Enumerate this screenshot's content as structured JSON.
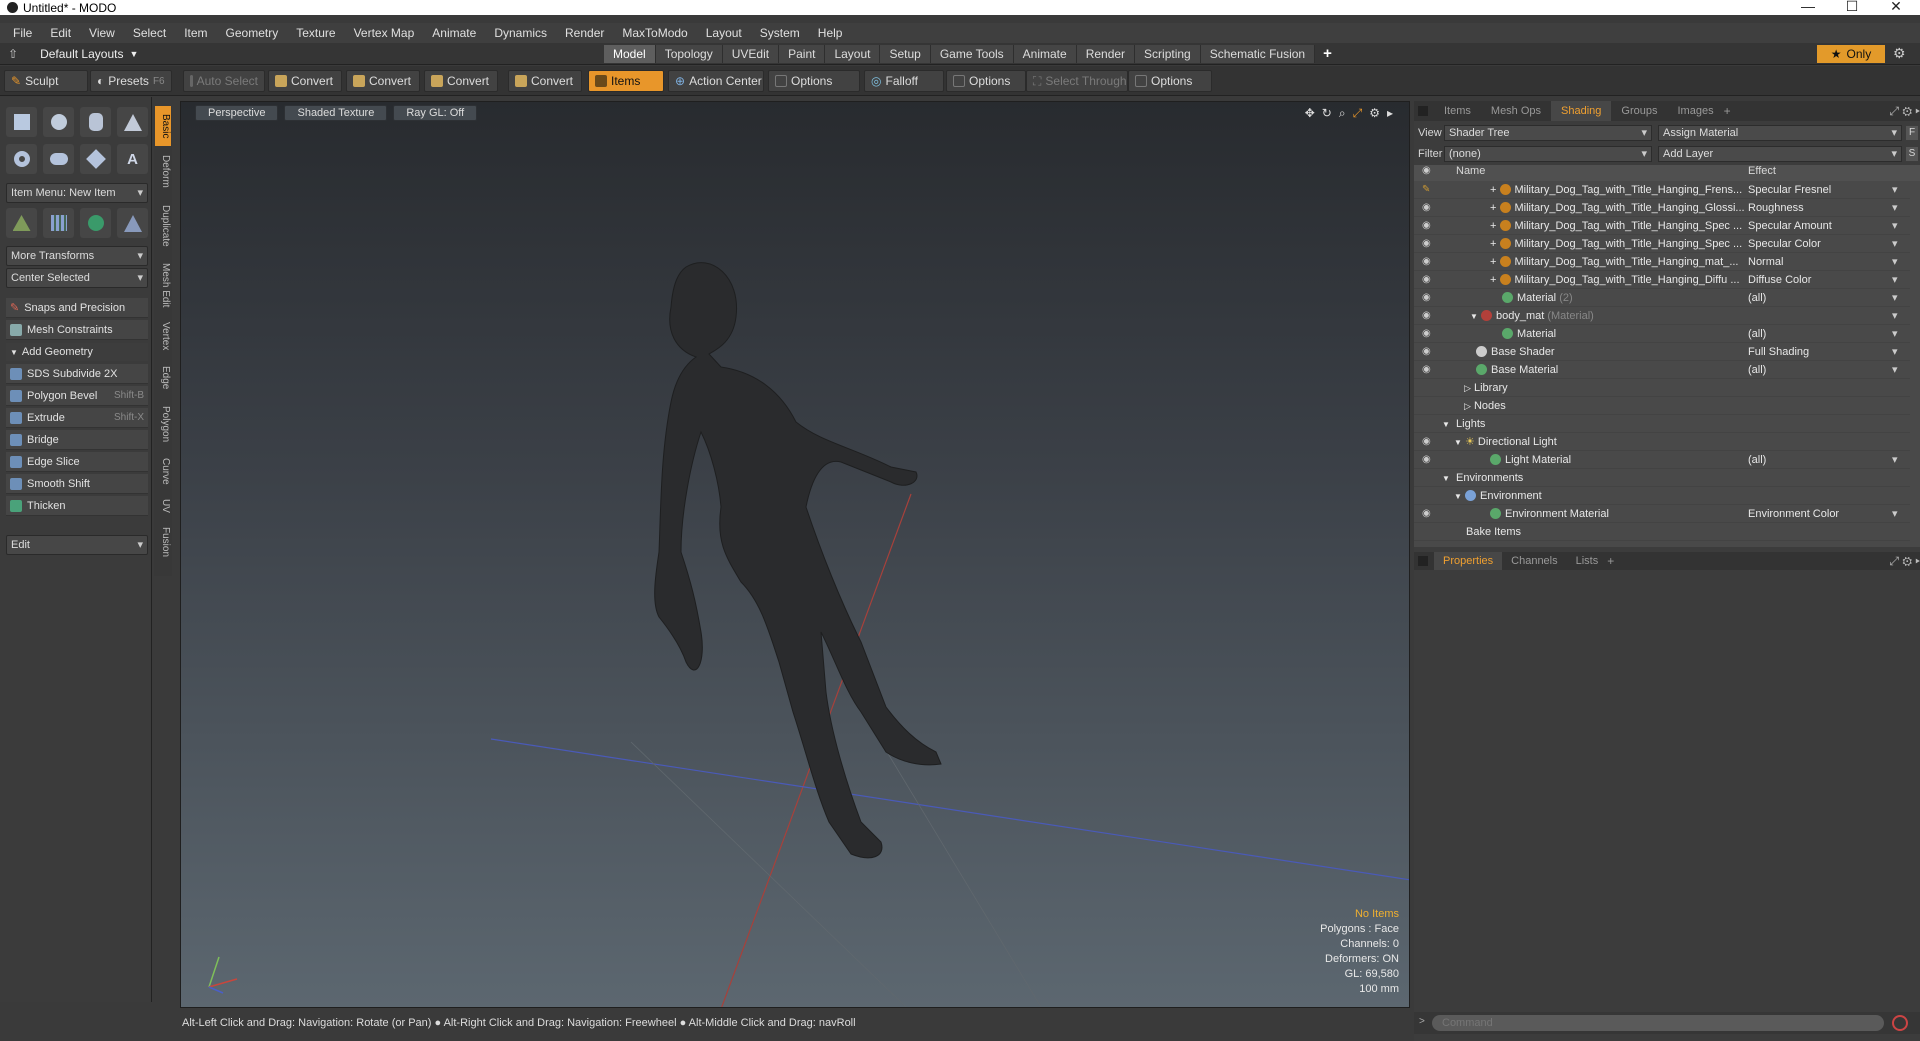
{
  "window": {
    "title": "Untitled* - MODO",
    "minimize": "—",
    "maximize": "☐",
    "close": "✕"
  },
  "menu": [
    "File",
    "Edit",
    "View",
    "Select",
    "Item",
    "Geometry",
    "Texture",
    "Vertex Map",
    "Animate",
    "Dynamics",
    "Render",
    "MaxToModo",
    "Layout",
    "System",
    "Help"
  ],
  "layout": {
    "name": "Default Layouts",
    "tabs": [
      "Model",
      "Topology",
      "UVEdit",
      "Paint",
      "Layout",
      "Setup",
      "Game Tools",
      "Animate",
      "Render",
      "Scripting",
      "Schematic Fusion"
    ],
    "active_tab": "Model",
    "plus": "+",
    "only_label": "Only"
  },
  "toolbar": {
    "sculpt": "Sculpt",
    "presets": "Presets",
    "presets_key": "F6",
    "auto_select": "Auto Select",
    "convert": "Convert",
    "items": "Items",
    "action_center": "Action Center",
    "options": "Options",
    "falloff": "Falloff",
    "select_through": "Select Through"
  },
  "left": {
    "item_menu": "Item Menu: New Item",
    "more_transforms": "More Transforms",
    "center_selected": "Center Selected",
    "snaps": "Snaps and Precision",
    "mesh_constraints": "Mesh Constraints",
    "add_geometry": "Add Geometry",
    "tools": [
      {
        "label": "SDS Subdivide 2X",
        "shortcut": ""
      },
      {
        "label": "Polygon Bevel",
        "shortcut": "Shift-B"
      },
      {
        "label": "Extrude",
        "shortcut": "Shift-X"
      },
      {
        "label": "Bridge",
        "shortcut": ""
      },
      {
        "label": "Edge Slice",
        "shortcut": ""
      },
      {
        "label": "Smooth Shift",
        "shortcut": ""
      },
      {
        "label": "Thicken",
        "shortcut": ""
      }
    ],
    "edit": "Edit",
    "vtabs": [
      "Basic",
      "Deform",
      "Duplicate",
      "Mesh Edit",
      "Vertex",
      "Edge",
      "Polygon",
      "Curve",
      "UV",
      "Fusion"
    ]
  },
  "viewport": {
    "tabs": [
      "Perspective",
      "Shaded Texture",
      "Ray GL: Off"
    ],
    "hud": {
      "items": "No Items",
      "polygons": "Polygons : Face",
      "channels": "Channels: 0",
      "deformers": "Deformers: ON",
      "gl": "GL: 69,580",
      "scale": "100 mm"
    }
  },
  "status": "Alt-Left Click and Drag: Navigation: Rotate (or Pan) ● Alt-Right Click and Drag: Navigation: Freewheel ● Alt-Middle Click and Drag: navRoll",
  "right": {
    "tabs": [
      "Items",
      "Mesh Ops",
      "Shading",
      "Groups",
      "Images"
    ],
    "active_tab": "Shading",
    "view_label": "View",
    "view_value": "Shader Tree",
    "assign_material": "Assign Material",
    "filter_label": "Filter",
    "filter_value": "(none)",
    "add_layer": "Add Layer",
    "col_name": "Name",
    "col_effect": "Effect",
    "rows": [
      {
        "name": "Military_Dog_Tag_with_Title_Hanging_Frens...",
        "effect": "Specular Fresnel"
      },
      {
        "name": "Military_Dog_Tag_with_Title_Hanging_Glossi...",
        "effect": "Roughness"
      },
      {
        "name": "Military_Dog_Tag_with_Title_Hanging_Spec ...",
        "effect": "Specular Amount"
      },
      {
        "name": "Military_Dog_Tag_with_Title_Hanging_Spec ...",
        "effect": "Specular Color"
      },
      {
        "name": "Military_Dog_Tag_with_Title_Hanging_mat_...",
        "effect": "Normal"
      },
      {
        "name": "Military_Dog_Tag_with_Title_Hanging_Diffu ...",
        "effect": "Diffuse Color"
      },
      {
        "name": "Material",
        "suffix": "(2)",
        "effect": "(all)"
      },
      {
        "name": "body_mat",
        "suffix": "(Material)",
        "effect": ""
      },
      {
        "name": "Material",
        "suffix": "",
        "effect": "(all)"
      },
      {
        "name": "Base Shader",
        "effect": "Full Shading"
      },
      {
        "name": "Base Material",
        "effect": "(all)"
      },
      {
        "name": "Library",
        "effect": ""
      },
      {
        "name": "Nodes",
        "effect": ""
      },
      {
        "name": "Lights",
        "effect": ""
      },
      {
        "name": "Directional Light",
        "effect": ""
      },
      {
        "name": "Light Material",
        "effect": "(all)"
      },
      {
        "name": "Environments",
        "effect": ""
      },
      {
        "name": "Environment",
        "effect": ""
      },
      {
        "name": "Environment Material",
        "effect": "Environment Color"
      },
      {
        "name": "Bake Items",
        "effect": ""
      }
    ],
    "prop_tabs": [
      "Properties",
      "Channels",
      "Lists"
    ],
    "prop_plus": "+",
    "command_placeholder": "Command"
  },
  "colors": {
    "accent": "#e8962a",
    "x_axis": "#c8463c",
    "z_axis": "#4a5fc8"
  }
}
